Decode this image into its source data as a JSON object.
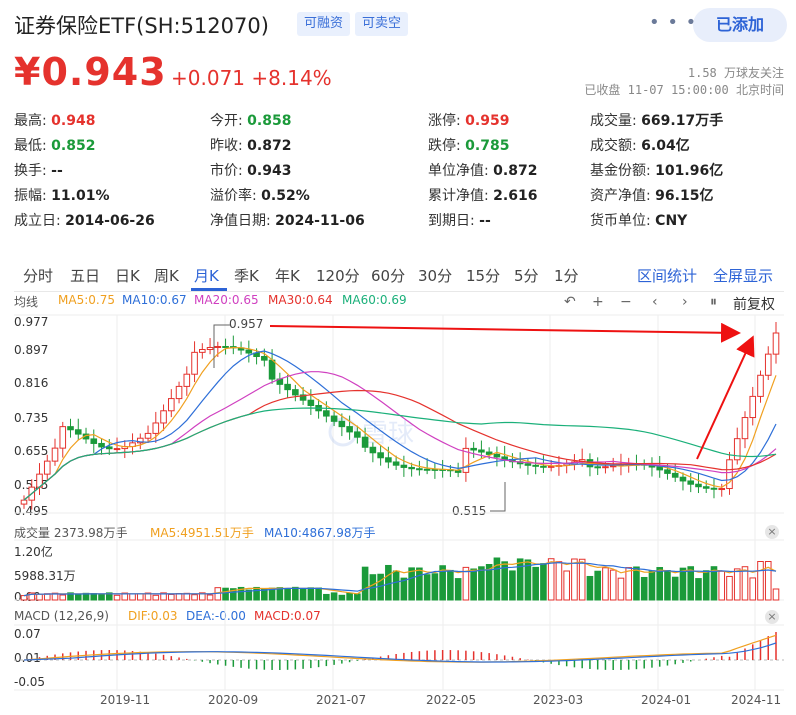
{
  "header": {
    "title": "证券保险ETF(SH:512070)",
    "tag_margin": "可融资",
    "tag_short": "可卖空",
    "more": "• • •",
    "add_button": "已添加"
  },
  "quote": {
    "price": "¥0.943",
    "change": "+0.071",
    "change_pct": "+8.14%",
    "followers": "1.58 万球友关注",
    "status": "已收盘 11-07 15:00:00 北京时间"
  },
  "stats": {
    "high_label": "最高:",
    "high": "0.948",
    "low_label": "最低:",
    "low": "0.852",
    "turnover_label": "换手:",
    "turnover": "--",
    "amplitude_label": "振幅:",
    "amplitude": "11.01%",
    "inception_label": "成立日:",
    "inception": "2014-06-26",
    "open_label": "今开:",
    "open": "0.858",
    "prevclose_label": "昨收:",
    "prevclose": "0.872",
    "mktprice_label": "市价:",
    "mktprice": "0.943",
    "premium_label": "溢价率:",
    "premium": "0.52%",
    "navdate_label": "净值日期:",
    "navdate": "2024-11-06",
    "limitup_label": "涨停:",
    "limitup": "0.959",
    "limitdown_label": "跌停:",
    "limitdown": "0.785",
    "nav_label": "单位净值:",
    "nav": "0.872",
    "accnav_label": "累计净值:",
    "accnav": "2.616",
    "maturity_label": "到期日:",
    "maturity": "--",
    "volume_label": "成交量:",
    "volume": "669.17万手",
    "amount_label": "成交额:",
    "amount": "6.04亿",
    "shares_label": "基金份额:",
    "shares": "101.96亿",
    "assets_label": "资产净值:",
    "assets": "96.15亿",
    "currency_label": "货币单位:",
    "currency": "CNY"
  },
  "tabs": [
    "分时",
    "五日",
    "日K",
    "周K",
    "月K",
    "季K",
    "年K",
    "120分",
    "60分",
    "30分",
    "15分",
    "5分",
    "1分"
  ],
  "active_tab": "月K",
  "tab_actions": {
    "range": "区间统计",
    "fullscreen": "全屏显示"
  },
  "ma_legend": {
    "label": "均线",
    "items": [
      {
        "text": "MA5:0.75",
        "color": "#f0a020"
      },
      {
        "text": "MA10:0.67",
        "color": "#2e6fd8"
      },
      {
        "text": "MA20:0.65",
        "color": "#d040c0"
      },
      {
        "text": "MA30:0.64",
        "color": "#e5322d"
      },
      {
        "text": "MA60:0.69",
        "color": "#1bb07a"
      }
    ]
  },
  "toolbar": {
    "undo": "↶",
    "zoom_in": "+",
    "zoom_out": "−",
    "left": "‹",
    "right": "›",
    "pause": "⏸",
    "adjust": "前复权"
  },
  "price_axis": [
    "0.977",
    "0.897",
    "0.816",
    "0.735",
    "0.655",
    "0.575",
    "0.495"
  ],
  "annotations": {
    "high": "0.957",
    "low": "0.515"
  },
  "volume_panel": {
    "title": "成交量 2373.98万手",
    "ma5": "MA5:4951.51万手",
    "ma10": "MA10:4867.98万手",
    "axis": [
      "1.20亿",
      "5988.31万",
      "0.00"
    ]
  },
  "macd_panel": {
    "title": "MACD (12,26,9)",
    "dif": "DIF:0.03",
    "dea": "DEA:-0.00",
    "macd": "MACD:0.07",
    "axis": [
      "0.07",
      "0.01",
      "-0.05"
    ]
  },
  "x_axis": [
    "2019-11",
    "2020-09",
    "2021-07",
    "2022-05",
    "2023-03",
    "2024-01",
    "2024-11"
  ],
  "colors": {
    "up": "#e5322d",
    "down": "#1b9a3a",
    "accent": "#2d63d6"
  }
}
